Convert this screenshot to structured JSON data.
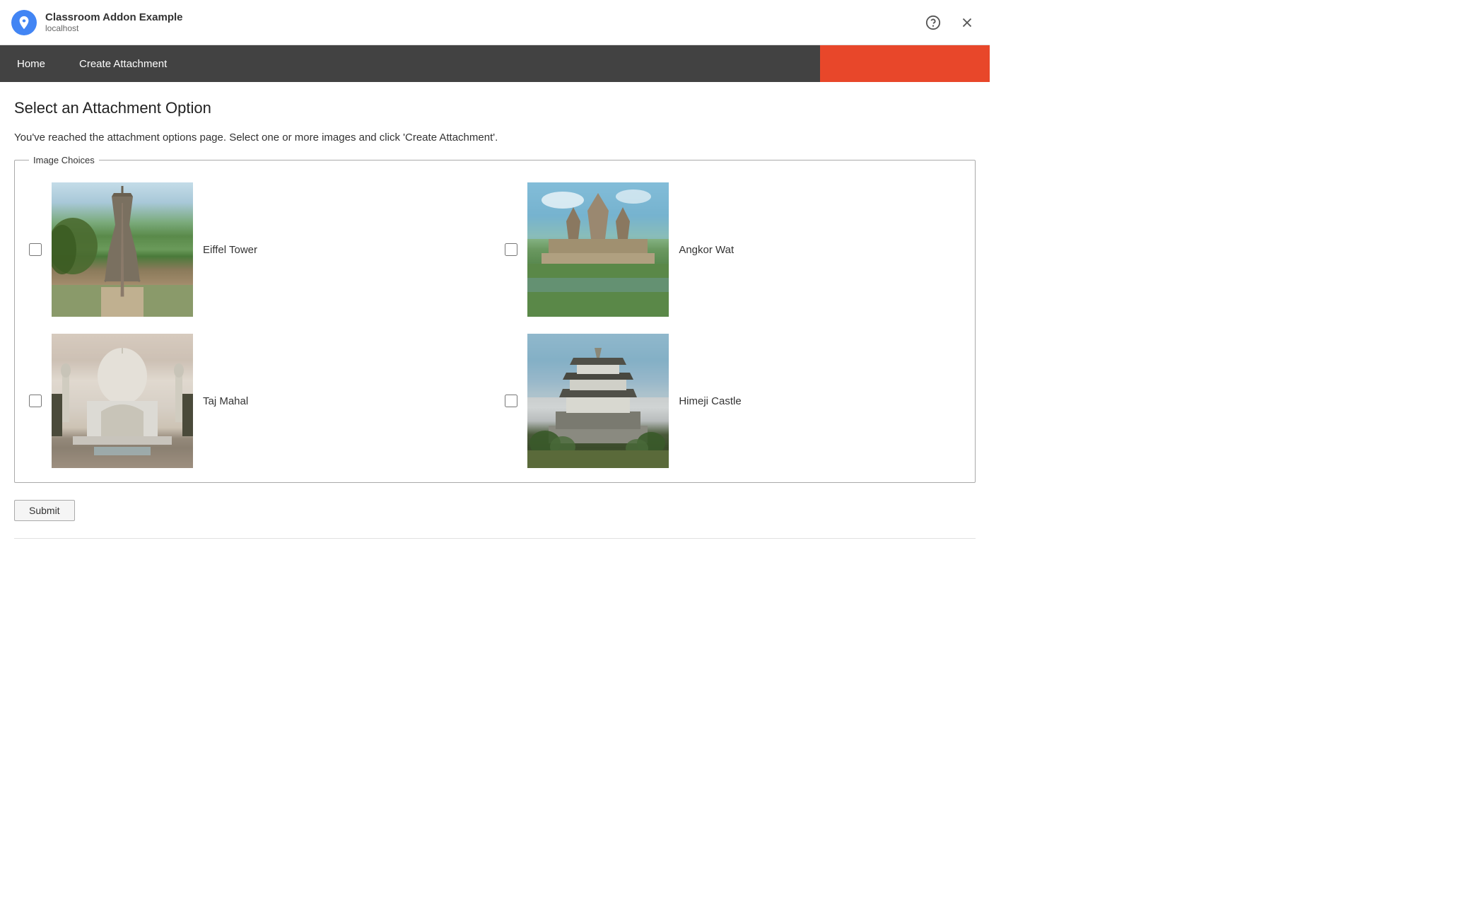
{
  "titlebar": {
    "app_name": "Classroom Addon Example",
    "app_url": "localhost",
    "help_icon": "?",
    "close_icon": "×"
  },
  "navbar": {
    "items": [
      {
        "id": "home",
        "label": "Home"
      },
      {
        "id": "create-attachment",
        "label": "Create Attachment"
      }
    ]
  },
  "page": {
    "title": "Select an Attachment Option",
    "description": "You've reached the attachment options page. Select one or more images and click 'Create Attachment'.",
    "fieldset_legend": "Image Choices",
    "images": [
      {
        "id": "eiffel",
        "label": "Eiffel Tower",
        "checked": false
      },
      {
        "id": "angkor",
        "label": "Angkor Wat",
        "checked": false
      },
      {
        "id": "taj",
        "label": "Taj Mahal",
        "checked": false
      },
      {
        "id": "himeji",
        "label": "Himeji Castle",
        "checked": false
      }
    ],
    "submit_label": "Submit"
  },
  "colors": {
    "nav_bg": "#424242",
    "nav_accent": "#e8472a",
    "nav_text": "#ffffff",
    "page_bg": "#ffffff"
  }
}
